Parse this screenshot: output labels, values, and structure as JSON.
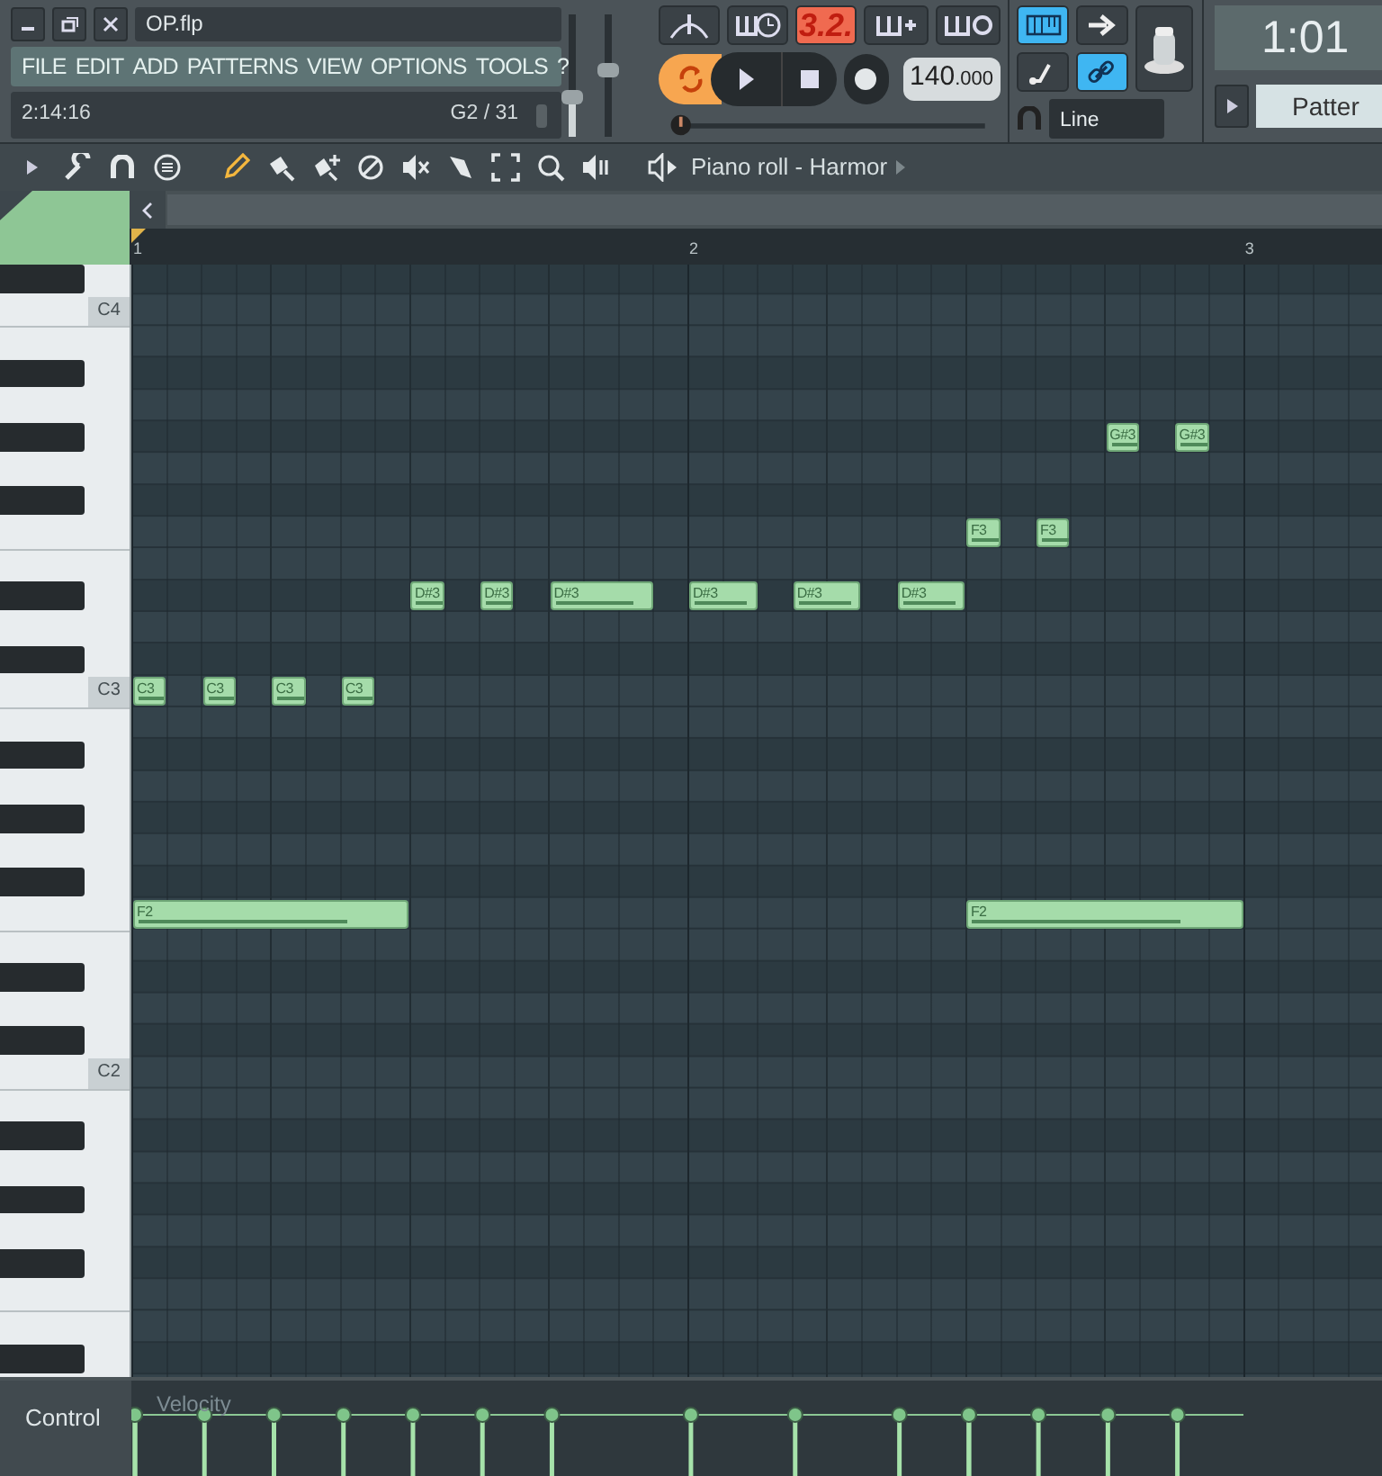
{
  "window": {
    "title": "OP.flp"
  },
  "menu": [
    "FILE",
    "EDIT",
    "ADD",
    "PATTERNS",
    "VIEW",
    "OPTIONS",
    "TOOLS",
    "?"
  ],
  "hint_bar": {
    "time": "2:14:16",
    "note_info": "G2 / 31"
  },
  "sliders": {
    "volume": {
      "level": 0.3
    },
    "pitch": {
      "level": 0.55
    },
    "master_pitch": {
      "level": 0
    }
  },
  "transport": {
    "pattern_display": "3.2.",
    "pattern_mode": true,
    "tempo_whole": "140",
    "tempo_fraction": ".000"
  },
  "snap_buttons": [
    {
      "kind": "keyboard",
      "on": true
    },
    {
      "kind": "arrow",
      "on": false
    },
    {
      "kind": "step",
      "on": false
    },
    {
      "kind": "link",
      "on": true
    }
  ],
  "snap": "Line",
  "song_time": "1:01",
  "pattern_selector": "Patter",
  "piano_roll": {
    "title": "Piano roll - Harmor",
    "tools": [
      {
        "kind": "pencil",
        "selected": true
      },
      {
        "kind": "brush",
        "selected": false
      },
      {
        "kind": "brush-plus",
        "selected": false
      },
      {
        "kind": "delete",
        "selected": false
      },
      {
        "kind": "mute",
        "selected": false
      },
      {
        "kind": "slice",
        "selected": false
      },
      {
        "kind": "select",
        "selected": false
      },
      {
        "kind": "zoom",
        "selected": false
      },
      {
        "kind": "playback",
        "selected": false
      }
    ],
    "bars": [
      "1",
      "2",
      "3"
    ],
    "keyboard_labels": [
      "C4",
      "C3",
      "C2"
    ],
    "notes": [
      {
        "label": "G#3"
      },
      {
        "label": "G#3"
      },
      {
        "label": "F3"
      },
      {
        "label": "F3"
      },
      {
        "label": "D#3"
      },
      {
        "label": "D#3"
      },
      {
        "label": "D#3"
      },
      {
        "label": "D#3"
      },
      {
        "label": "D#3"
      },
      {
        "label": "D#3"
      },
      {
        "label": "C3"
      },
      {
        "label": "C3"
      },
      {
        "label": "C3"
      },
      {
        "label": "C3"
      },
      {
        "label": "F2"
      },
      {
        "label": "F2"
      }
    ],
    "control": {
      "label": "Control",
      "lane": "Velocity"
    }
  }
}
